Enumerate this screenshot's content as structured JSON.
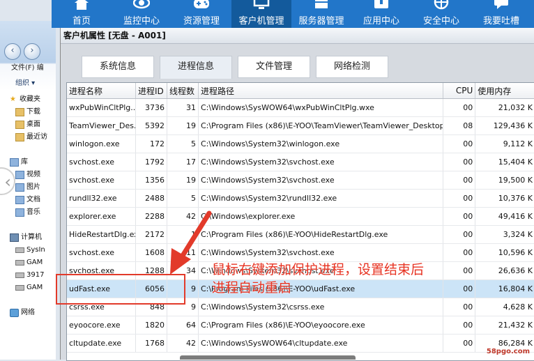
{
  "nav": {
    "items": [
      {
        "label": "首页",
        "icon": "home-icon"
      },
      {
        "label": "监控中心",
        "icon": "eye-icon"
      },
      {
        "label": "资源管理",
        "icon": "gamepad-icon"
      },
      {
        "label": "客户机管理",
        "icon": "monitor-icon",
        "active": true
      },
      {
        "label": "服务器管理",
        "icon": "server-icon"
      },
      {
        "label": "应用中心",
        "icon": "app-icon"
      },
      {
        "label": "安全中心",
        "icon": "shield-icon"
      },
      {
        "label": "我要吐槽",
        "icon": "chat-icon"
      }
    ]
  },
  "explorer": {
    "menu": "文件(F)  编",
    "organize": "组织 ▾",
    "items": [
      {
        "label": "收藏夹",
        "icon": "star-icon",
        "indent": false
      },
      {
        "label": "下载",
        "icon": "folder-icon",
        "indent": true
      },
      {
        "label": "桌面",
        "icon": "folder-icon",
        "indent": true
      },
      {
        "label": "最近访",
        "icon": "folder-icon",
        "indent": true
      },
      {
        "label": "",
        "icon": "",
        "indent": false
      },
      {
        "label": "库",
        "icon": "library-icon",
        "indent": false
      },
      {
        "label": "视频",
        "icon": "library-icon",
        "indent": true
      },
      {
        "label": "图片",
        "icon": "library-icon",
        "indent": true
      },
      {
        "label": "文档",
        "icon": "library-icon",
        "indent": true
      },
      {
        "label": "音乐",
        "icon": "library-icon",
        "indent": true
      },
      {
        "label": "",
        "icon": "",
        "indent": false
      },
      {
        "label": "计算机",
        "icon": "computer-icon",
        "indent": false
      },
      {
        "label": "SysIn",
        "icon": "drive-icon",
        "indent": true
      },
      {
        "label": "GAM",
        "icon": "drive-icon",
        "indent": true
      },
      {
        "label": "3917",
        "icon": "drive-icon",
        "indent": true
      },
      {
        "label": "GAM",
        "icon": "drive-icon",
        "indent": true
      },
      {
        "label": "",
        "icon": "",
        "indent": false
      },
      {
        "label": "网络",
        "icon": "network-icon",
        "indent": false
      }
    ]
  },
  "dialog": {
    "title": "客户机属性 [无盘 - A001]",
    "tabs": [
      "系统信息",
      "进程信息",
      "文件管理",
      "网络检测"
    ],
    "active_tab": 1,
    "columns": [
      "进程名称",
      "进程ID",
      "线程数",
      "进程路径",
      "CPU",
      "使用内存"
    ],
    "rows": [
      [
        "wxPubWinCltPlg....",
        "3736",
        "31",
        "C:\\Windows\\SysWOW64\\wxPubWinCltPlg.wxe",
        "00",
        "21,032 K"
      ],
      [
        "TeamViewer_Des...",
        "5392",
        "19",
        "C:\\Program Files (x86)\\E-YOO\\TeamViewer\\TeamViewer_Desktop....",
        "08",
        "129,436 K"
      ],
      [
        "winlogon.exe",
        "172",
        "5",
        "C:\\Windows\\System32\\winlogon.exe",
        "00",
        "9,112 K"
      ],
      [
        "svchost.exe",
        "1792",
        "17",
        "C:\\Windows\\System32\\svchost.exe",
        "00",
        "15,404 K"
      ],
      [
        "svchost.exe",
        "1356",
        "19",
        "C:\\Windows\\System32\\svchost.exe",
        "00",
        "19,500 K"
      ],
      [
        "rundll32.exe",
        "2488",
        "5",
        "C:\\Windows\\System32\\rundll32.exe",
        "00",
        "10,376 K"
      ],
      [
        "explorer.exe",
        "2288",
        "42",
        "C:\\Windows\\explorer.exe",
        "00",
        "49,416 K"
      ],
      [
        "HideRestartDlg.exe",
        "2172",
        "1",
        "C:\\Program Files (x86)\\E-YOO\\HideRestartDlg.exe",
        "00",
        "3,324 K"
      ],
      [
        "svchost.exe",
        "1608",
        "11",
        "C:\\Windows\\System32\\svchost.exe",
        "00",
        "10,596 K"
      ],
      [
        "svchost.exe",
        "1288",
        "34",
        "C:\\Windows\\System32\\svchost.exe",
        "00",
        "26,636 K"
      ],
      [
        "udFast.exe",
        "6056",
        "9",
        "C:\\Program Files (x86)\\E-YOO\\udFast.exe",
        "00",
        "16,804 K"
      ],
      [
        "csrss.exe",
        "848",
        "9",
        "C:\\Windows\\System32\\csrss.exe",
        "00",
        "4,628 K"
      ],
      [
        "eyoocore.exe",
        "1820",
        "64",
        "C:\\Program Files (x86)\\E-YOO\\eyoocore.exe",
        "00",
        "21,432 K"
      ],
      [
        "cltupdate.exe",
        "1768",
        "42",
        "C:\\Windows\\SysWOW64\\cltupdate.exe",
        "00",
        "86,284 K"
      ]
    ],
    "selected_row": 10
  },
  "annotation": {
    "line1": "鼠标右键添加保护进程，设置结束后",
    "line2": "进程自动重启",
    "color": "#e73322"
  },
  "watermark": "58pgo.com"
}
